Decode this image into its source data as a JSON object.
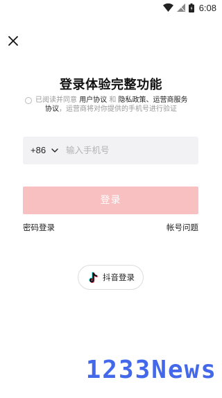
{
  "status_bar": {
    "time": "6:08"
  },
  "page": {
    "title": "登录体验完整功能",
    "agreement": {
      "prefix": "已阅读并同意 ",
      "user_agreement": "用户协议",
      "and": " 和 ",
      "privacy": "隐私政策、运营商服务",
      "line2_link": "协议",
      "line2_rest": "，运营商将对你提供的手机号进行验证"
    },
    "phone": {
      "country_code": "+86",
      "placeholder": "输入手机号"
    },
    "login_button": "登录",
    "password_login": "密码登录",
    "account_problem": "帐号问题",
    "douyin_login": "抖音登录"
  },
  "watermark": "1233News",
  "colors": {
    "login_button": "#f9c0c2",
    "watermark": "#2f59e8"
  }
}
